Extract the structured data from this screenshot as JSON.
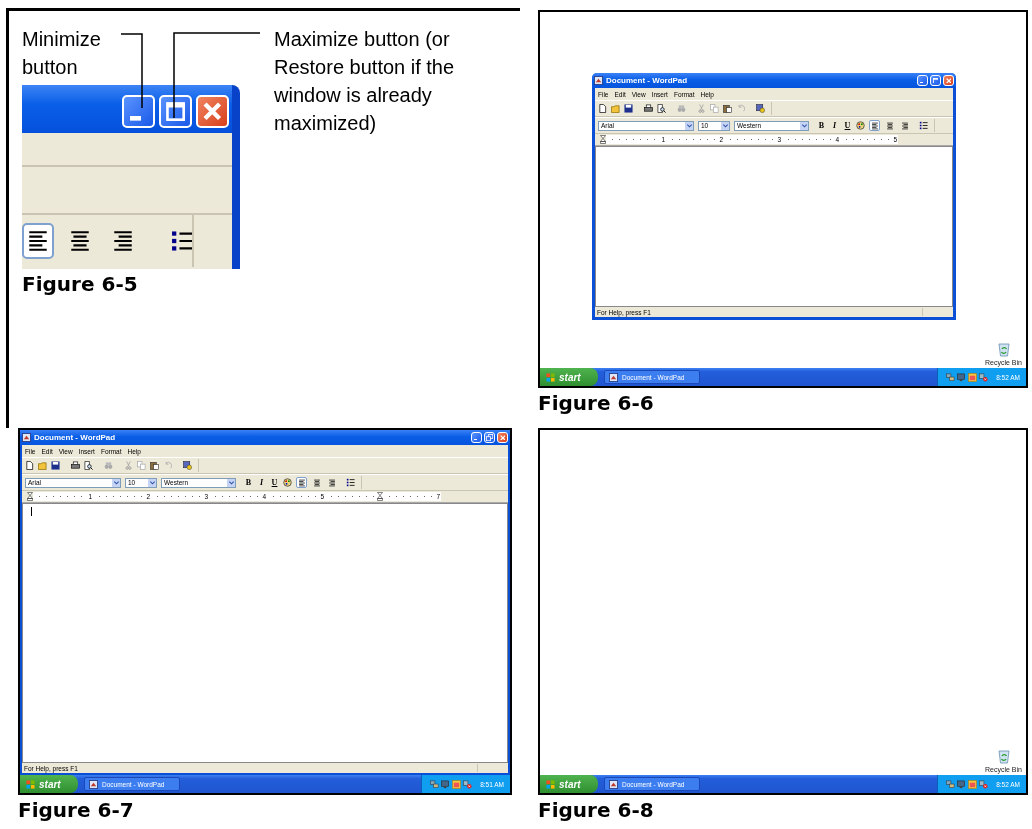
{
  "figures": [
    {
      "kind": "closeup",
      "callouts": [
        "Minimize button",
        "Maximize button (or Restore button if the window is already maximized)"
      ],
      "maximized": false,
      "align_buttons": [
        {
          "selected": true
        },
        {
          "selected": false
        },
        {
          "selected": false
        }
      ],
      "caption": "Figure 6-5"
    },
    {
      "kind": "desktop",
      "window": {
        "title": "Document - WordPad",
        "maximized": false,
        "menus": [
          "File",
          "Edit",
          "View",
          "Insert",
          "Format",
          "Help"
        ],
        "font": "Arial",
        "size": "10",
        "script": "Western",
        "format_buttons": [
          "B",
          "I",
          "U"
        ],
        "align_buttons": [
          {
            "selected": true
          },
          {
            "selected": false
          },
          {
            "selected": false
          }
        ],
        "ruler": [
          {
            "kind": "number",
            "label": "1"
          },
          {
            "kind": "number",
            "label": "2"
          },
          {
            "kind": "number",
            "label": "3"
          },
          {
            "kind": "number",
            "label": "4"
          },
          {
            "kind": "number",
            "label": "5"
          }
        ],
        "caret": false,
        "status": "For Help, press F1"
      },
      "desktop_icons": [
        {
          "label": "Recycle Bin"
        }
      ],
      "taskbar": {
        "start": "start",
        "tasks": [
          "Document - WordPad"
        ],
        "clock": "8:52 AM"
      },
      "caption": "Figure 6-6"
    },
    {
      "kind": "desktop",
      "window": {
        "title": "Document - WordPad",
        "maximized": true,
        "menus": [
          "File",
          "Edit",
          "View",
          "Insert",
          "Format",
          "Help"
        ],
        "font": "Arial",
        "size": "10",
        "script": "Western",
        "format_buttons": [
          "B",
          "I",
          "U"
        ],
        "align_buttons": [
          {
            "selected": true
          },
          {
            "selected": false
          },
          {
            "selected": false
          }
        ],
        "ruler": [
          {
            "kind": "number",
            "label": "1"
          },
          {
            "kind": "number",
            "label": "2"
          },
          {
            "kind": "number",
            "label": "3"
          },
          {
            "kind": "number",
            "label": "4"
          },
          {
            "kind": "number",
            "label": "5"
          },
          {
            "kind": "marker"
          },
          {
            "kind": "number",
            "label": "7"
          }
        ],
        "caret": true,
        "status": "For Help, press F1"
      },
      "taskbar": {
        "start": "start",
        "tasks": [
          "Document - WordPad"
        ],
        "clock": "8:51 AM"
      },
      "caption": "Figure 6-7"
    },
    {
      "kind": "desktop",
      "desktop_icons": [
        {
          "label": "Recycle Bin"
        }
      ],
      "taskbar": {
        "start": "start",
        "tasks": [
          "Document - WordPad"
        ],
        "clock": "8:52 AM"
      },
      "caption": "Figure 6-8"
    }
  ]
}
